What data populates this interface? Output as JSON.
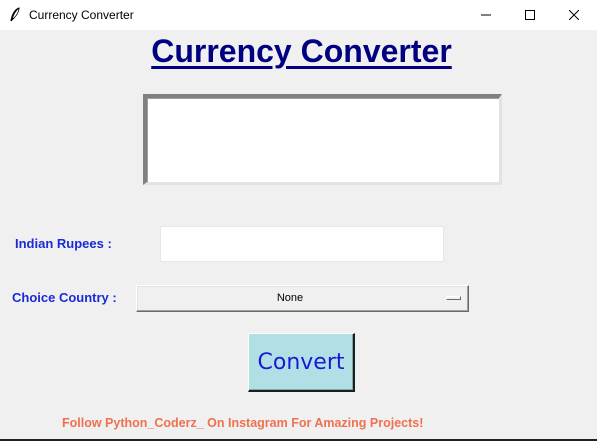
{
  "window": {
    "title": "Currency Converter",
    "icon": "feather-icon",
    "controls": [
      "minimize-icon",
      "maximize-icon",
      "close-icon"
    ]
  },
  "main": {
    "heading": "Currency Converter",
    "output_text": "",
    "rupees_label": "Indian Rupees :",
    "rupees_value": "",
    "country_label": "Choice Country :",
    "country_selected": "None",
    "convert_label": "Convert",
    "footer_text": "Follow Python_Coderz_ On Instagram For Amazing Projects!"
  },
  "colors": {
    "heading": "#000080",
    "labels": "#1a2ad6",
    "button_bg": "#b0e0e6",
    "button_text": "#1a1ad6",
    "footer": "#f07050",
    "background": "#f0f0f0"
  }
}
